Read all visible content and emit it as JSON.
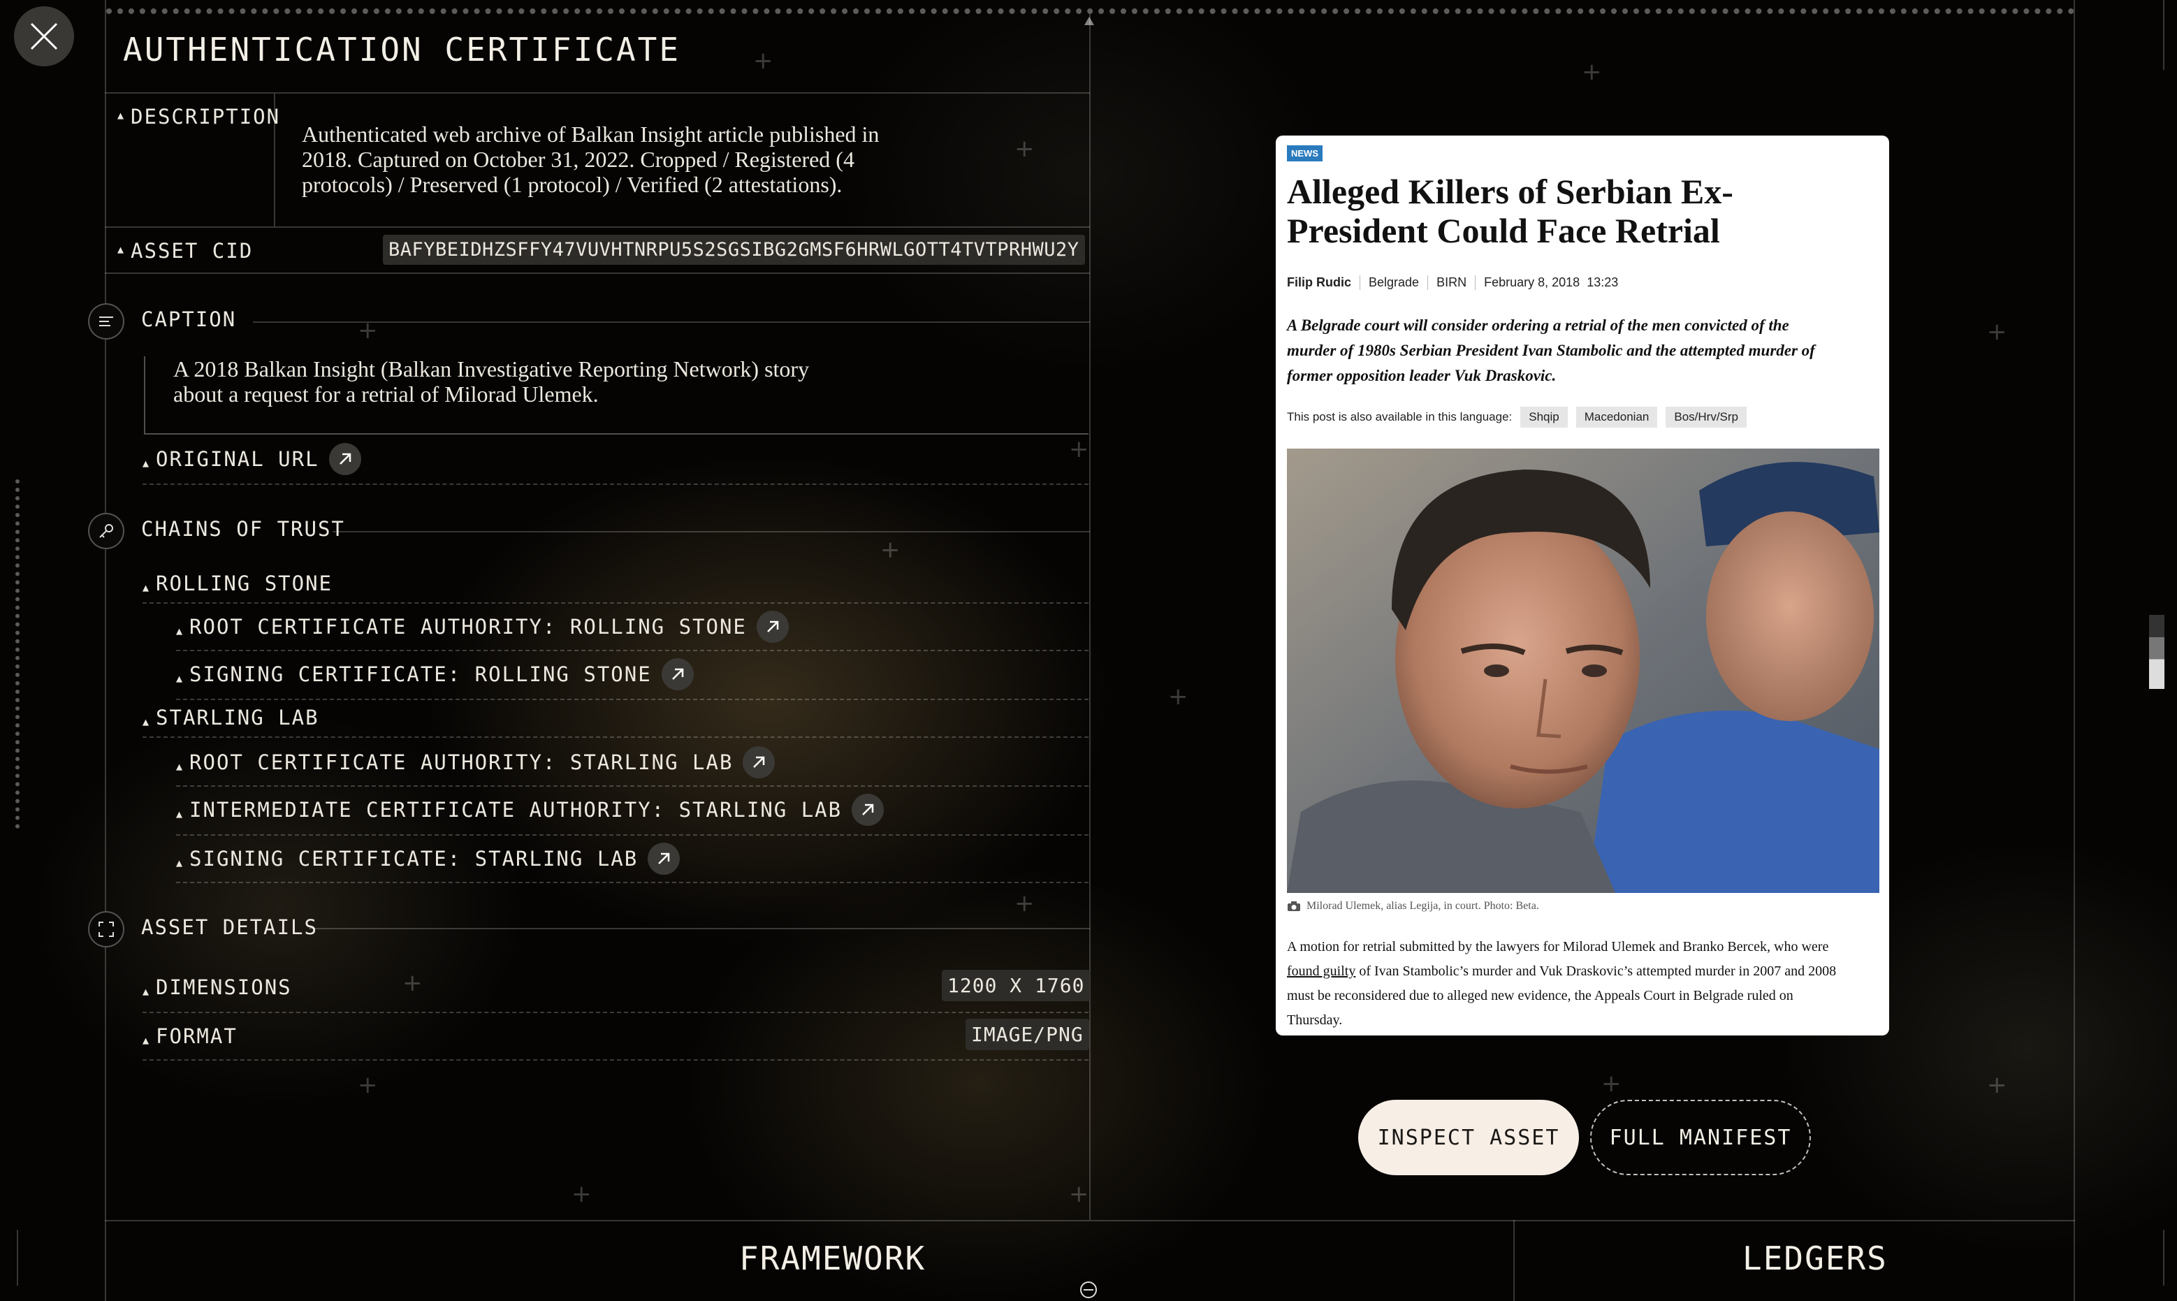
{
  "header": {
    "title": "AUTHENTICATION CERTIFICATE"
  },
  "description": {
    "label": "DESCRIPTION",
    "line1": "Authenticated web archive of Balkan Insight article published in",
    "line2": "2018. Captured on October 31, 2022. Cropped / Registered (4",
    "line3": "protocols) / Preserved (1 protocol) / Verified (2 attestations)."
  },
  "asset_cid": {
    "label": "ASSET CID",
    "value": "BAFYBEIDHZSFFY47VUVHTNRPU5S2SGSIBG2GMSF6HRWLGOTT4TVTPRHWU2Y"
  },
  "caption": {
    "label": "CAPTION",
    "line1": "A 2018 Balkan Insight (Balkan Investigative Reporting Network) story",
    "line2": "about a request for a retrial of Milorad Ulemek.",
    "original_url_label": "ORIGINAL URL"
  },
  "chains": {
    "label": "CHAINS OF TRUST",
    "groups": [
      {
        "name": "ROLLING STONE",
        "items": [
          "ROOT CERTIFICATE AUTHORITY: ROLLING STONE",
          "SIGNING CERTIFICATE: ROLLING STONE"
        ]
      },
      {
        "name": "STARLING LAB",
        "items": [
          "ROOT CERTIFICATE AUTHORITY: STARLING LAB",
          "INTERMEDIATE CERTIFICATE AUTHORITY: STARLING LAB",
          "SIGNING CERTIFICATE: STARLING LAB"
        ]
      }
    ]
  },
  "asset_details": {
    "label": "ASSET DETAILS",
    "dimensions_label": "DIMENSIONS",
    "dimensions_value": "1200 X 1760",
    "format_label": "FORMAT",
    "format_value": "IMAGE/PNG"
  },
  "article": {
    "badge": "NEWS",
    "title_line1": "Alleged Killers of Serbian Ex-",
    "title_line2": "President Could Face Retrial",
    "author": "Filip Rudic",
    "location": "Belgrade",
    "source": "BIRN",
    "date": "February 8, 2018",
    "time": "13:23",
    "lede_line1": "A Belgrade court will consider ordering a retrial of the men convicted of the",
    "lede_line2": "murder of 1980s Serbian President Ivan Stambolic and the attempted murder of",
    "lede_line3": "former opposition leader Vuk Draskovic.",
    "lang_note": "This post is also available in this language:",
    "languages": [
      "Shqip",
      "Macedonian",
      "Bos/Hrv/Srp"
    ],
    "photo_caption": "Milorad Ulemek, alias Legija, in court. Photo: Beta.",
    "body_line1": "A motion for retrial submitted by the lawyers for Milorad Ulemek and Branko Bercek, who were",
    "body_link": "found guilty",
    "body_line2": " of Ivan Stambolic’s murder and Vuk Draskovic’s attempted murder in 2007 and 2008",
    "body_line3": "must be reconsidered due to alleged new evidence, the Appeals Court in Belgrade ruled on",
    "body_line4": "Thursday."
  },
  "actions": {
    "inspect": "INSPECT ASSET",
    "manifest": "FULL MANIFEST"
  },
  "footer": {
    "left": "FRAMEWORK",
    "right": "LEDGERS"
  },
  "icons": [
    "close-icon",
    "caption-icon",
    "key-icon",
    "expand-icon",
    "external-link-icon",
    "camera-icon"
  ]
}
